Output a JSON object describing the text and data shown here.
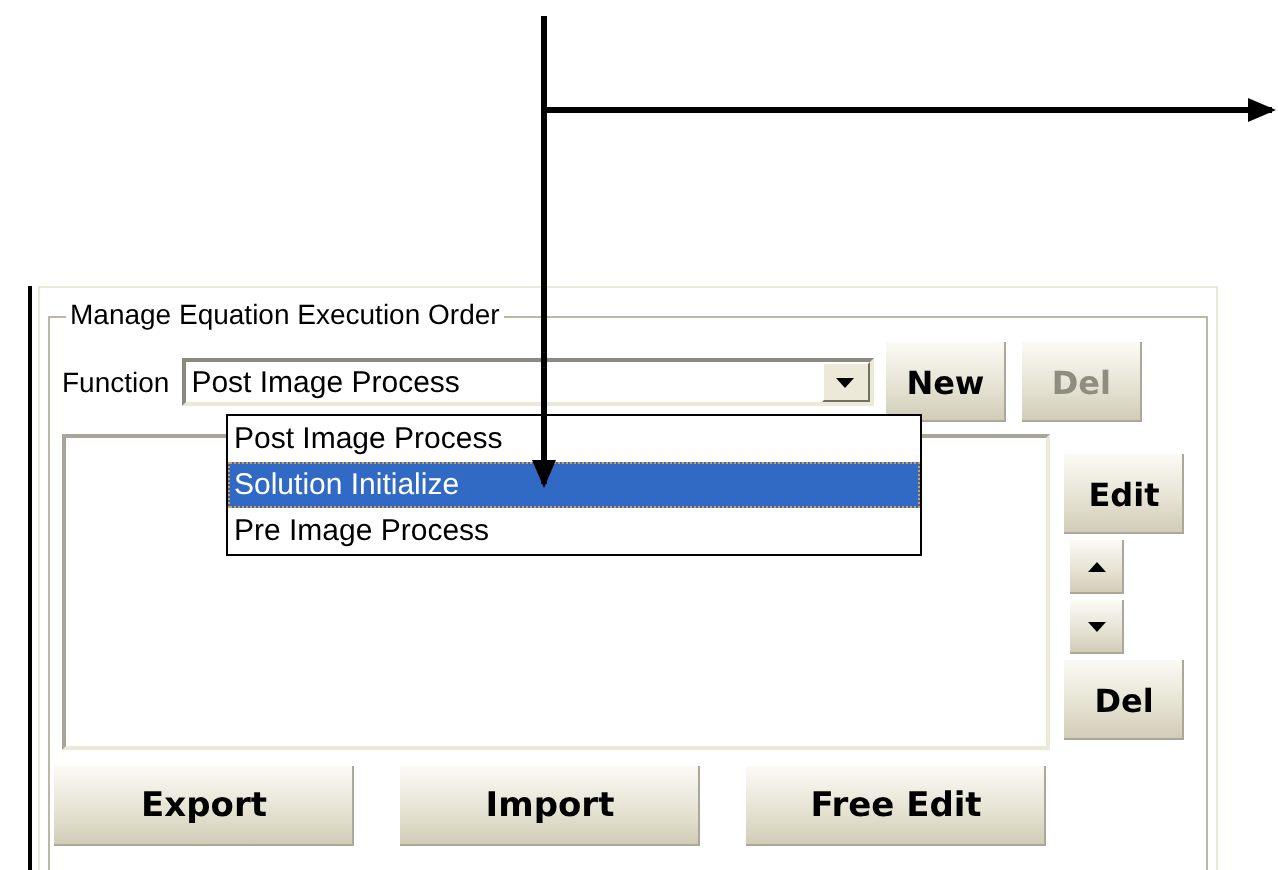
{
  "group": {
    "title": "Manage Equation Execution Order"
  },
  "function": {
    "label": "Function",
    "value": "Post Image Process",
    "new_button": {
      "label": "New",
      "disabled": false
    },
    "del_button": {
      "label": "Del",
      "disabled": true
    }
  },
  "dropdown": [
    {
      "label": "Post Image Process",
      "selected": false
    },
    {
      "label": "Solution Initialize",
      "selected": true
    },
    {
      "label": "Pre Image Process",
      "selected": false
    }
  ],
  "side_buttons": [
    {
      "kind": "text",
      "label": "Edit",
      "disabled": false
    },
    {
      "kind": "up"
    },
    {
      "kind": "down"
    },
    {
      "kind": "text",
      "label": "Del",
      "disabled": false
    }
  ],
  "bottom_buttons": [
    {
      "label": "Export",
      "disabled": false
    },
    {
      "label": "Import",
      "disabled": false
    },
    {
      "label": "Free Edit",
      "disabled": false
    }
  ]
}
